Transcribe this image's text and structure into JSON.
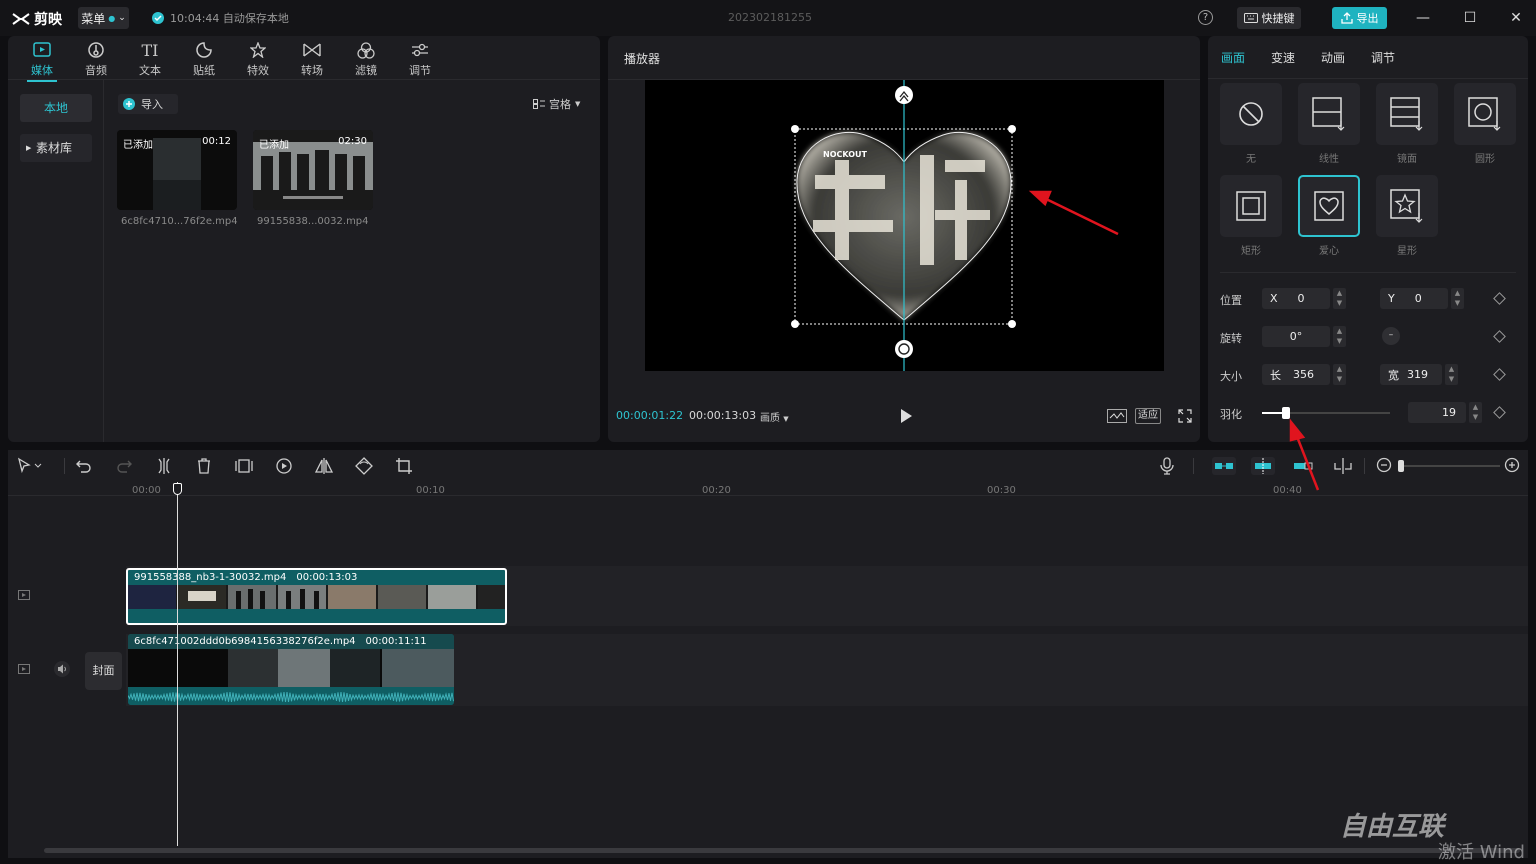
{
  "app": {
    "name": "剪映",
    "menu_label": "菜单",
    "autosave": "10:04:44 自动保存本地",
    "project_title": "202302181255",
    "help": "?",
    "shortcut_label": "快捷键",
    "export_label": "导出",
    "win_min": "—",
    "win_max": "☐",
    "win_close": "✕"
  },
  "media_tabs": [
    {
      "label": "媒体",
      "icon": "media-icon"
    },
    {
      "label": "音频",
      "icon": "audio-icon"
    },
    {
      "label": "文本",
      "icon": "text-icon"
    },
    {
      "label": "贴纸",
      "icon": "sticker-icon"
    },
    {
      "label": "特效",
      "icon": "effects-icon"
    },
    {
      "label": "转场",
      "icon": "transition-icon"
    },
    {
      "label": "滤镜",
      "icon": "filter-icon"
    },
    {
      "label": "调节",
      "icon": "adjust-icon"
    }
  ],
  "media_sidebar": {
    "local": "本地",
    "library": "素材库"
  },
  "media_main": {
    "import_label": "导入",
    "view_label": "宫格"
  },
  "media_items": [
    {
      "badge": "已添加",
      "duration": "00:12",
      "filename": "6c8fc4710...76f2e.mp4"
    },
    {
      "badge": "已添加",
      "duration": "02:30",
      "filename": "99155838...0032.mp4"
    }
  ],
  "player": {
    "title": "播放器",
    "current_time": "00:00:01:22",
    "total_time": "00:00:13:03",
    "quality_label": "画质",
    "fit_label": "适应",
    "canvas_text": "NOCKOUT"
  },
  "props": {
    "tabs": [
      "画面",
      "变速",
      "动画",
      "调节"
    ],
    "masks": [
      {
        "label": "无",
        "icon": "none-mask-icon"
      },
      {
        "label": "线性",
        "icon": "linear-mask-icon"
      },
      {
        "label": "镜面",
        "icon": "mirror-mask-icon"
      },
      {
        "label": "圆形",
        "icon": "circle-mask-icon"
      },
      {
        "label": "矩形",
        "icon": "rect-mask-icon"
      },
      {
        "label": "爱心",
        "icon": "heart-mask-icon"
      },
      {
        "label": "星形",
        "icon": "star-mask-icon"
      }
    ],
    "selected_mask": "爱心",
    "position_label": "位置",
    "x_label": "X",
    "x_value": "0",
    "y_label": "Y",
    "y_value": "0",
    "rotate_label": "旋转",
    "rotate_value": "0°",
    "size_label": "大小",
    "length_label": "长",
    "length_value": "356",
    "width_label": "宽",
    "width_value": "319",
    "feather_label": "羽化",
    "feather_value": "19",
    "feather_fraction": 0.19
  },
  "timeline": {
    "ruler": [
      "00:00",
      "00:10",
      "00:20",
      "00:30",
      "00:40"
    ],
    "cover_label": "封面",
    "clip1": {
      "name": "991558388_nb3-1-30032.mp4",
      "duration": "00:00:13:03"
    },
    "clip2": {
      "name": "6c8fc471002ddd0b6984156338276f2e.mp4",
      "duration": "00:00:11:11"
    }
  },
  "watermark": {
    "text1": "自由互联",
    "text2": "激活 Wind"
  },
  "colors": {
    "accent": "#2ec3d0",
    "clip": "#0f5e63",
    "annotation": "#e0141e"
  }
}
